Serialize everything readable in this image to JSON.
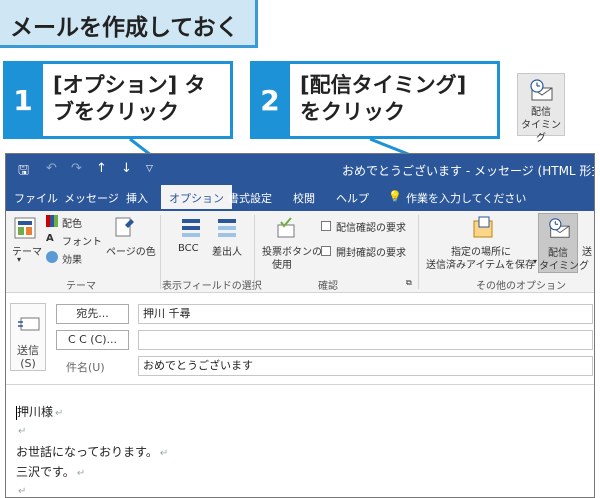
{
  "heading": "メールを作成しておく",
  "callouts": [
    {
      "num": "1",
      "line1": "[オプション] タ",
      "line2": "ブをクリック"
    },
    {
      "num": "2",
      "line1": "[配信タイミング]",
      "line2": "をクリック"
    }
  ],
  "corner_button": {
    "line1": "配信",
    "line2": "タイミング",
    "icon": "delay-delivery-icon"
  },
  "window": {
    "title": "おめでとうございます - メッセージ (HTML 形式)",
    "tabs": [
      "ファイル",
      "メッセージ",
      "挿入",
      "オプション",
      "書式設定",
      "校閲",
      "ヘルプ"
    ],
    "active_tab": "オプション",
    "tell_me": "作業を入力してください",
    "ribbon": {
      "theme_label": "テーマ",
      "colors_label": "配色",
      "fonts_label": "フォント",
      "effects_label": "効果",
      "page_color_label": "ページの色",
      "bcc_label": "BCC",
      "from_label": "差出人",
      "voting_line1": "投票ボタンの",
      "voting_line2": "使用",
      "read_receipt_label": "配信確認の要求",
      "open_receipt_label": "開封確認の要求",
      "save_sent_line1": "指定の場所に",
      "save_sent_line2": "送信済みアイテムを保存",
      "delay_line1": "配信",
      "delay_line2": "タイミング",
      "partial_label": "送",
      "group_themes": "テーマ",
      "group_fields": "表示フィールドの選択",
      "group_tracking": "確認",
      "group_more": "その他のオプション"
    },
    "compose": {
      "send_line1": "送信",
      "send_line2": "(S)",
      "to_label": "宛先...",
      "to_value": "押川 千尋",
      "cc_label": "C C (C)...",
      "cc_value": "",
      "subject_label": "件名(U)",
      "subject_value": "おめでとうございます"
    },
    "body_lines": [
      "押川様",
      "",
      "お世話になっております。",
      "三沢です。",
      ""
    ]
  }
}
